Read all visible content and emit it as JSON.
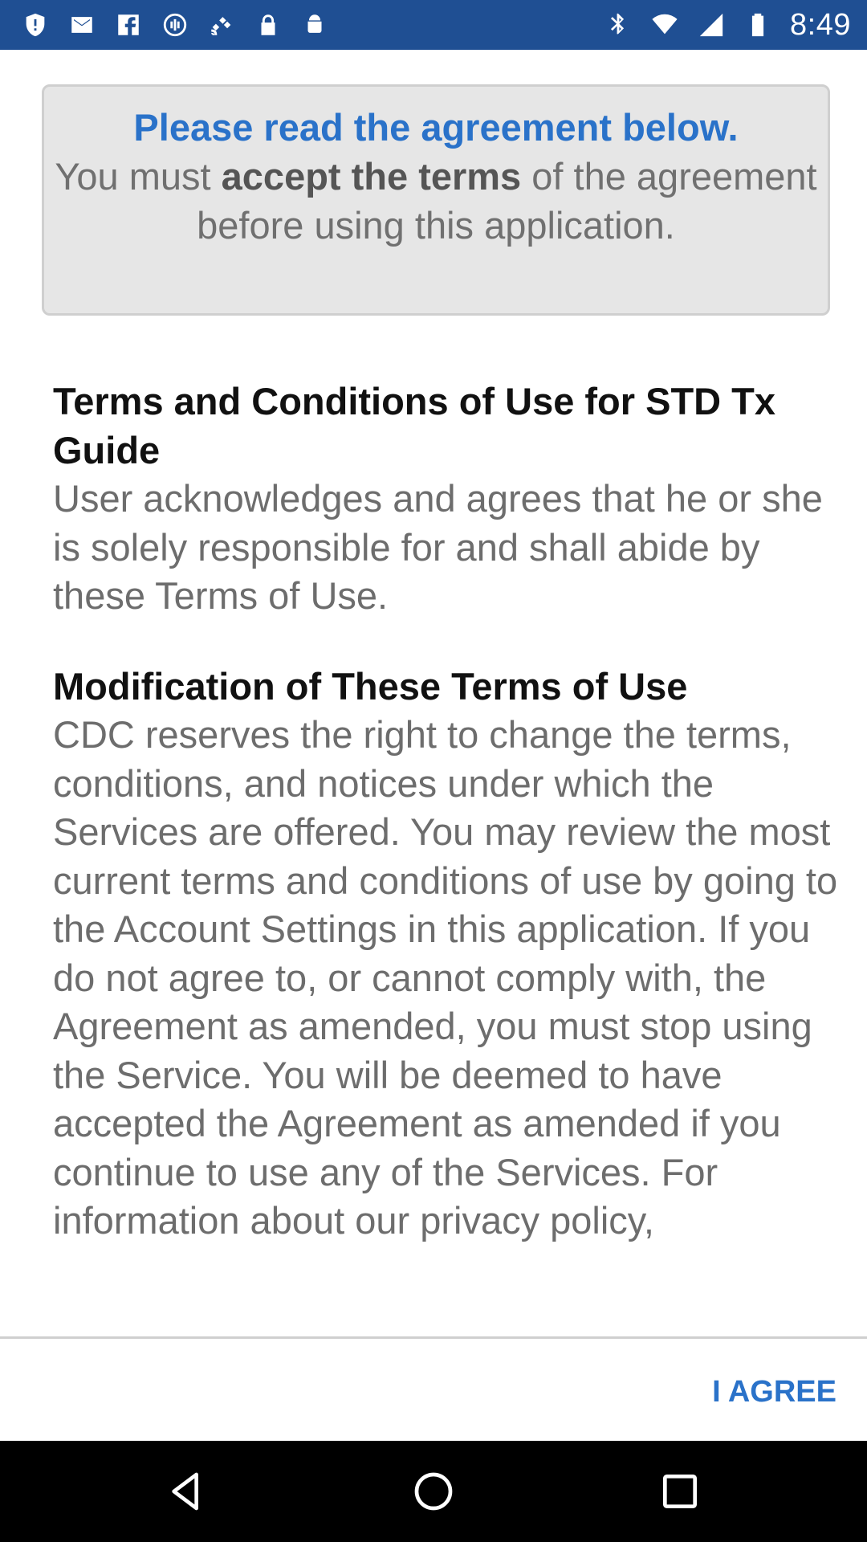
{
  "status_bar": {
    "time": "8:49",
    "icons": [
      "shield-icon",
      "mail-icon",
      "facebook-icon",
      "sync-circle-icon",
      "fake-gps-satellite-icon",
      "lock-icon",
      "android-icon",
      "bluetooth-icon",
      "wifi-icon",
      "signal-icon",
      "battery-icon"
    ]
  },
  "notice": {
    "lead": "Please read the agreement below.",
    "text_before": "You must ",
    "text_bold": "accept the terms",
    "text_after": " of the agreement before using this application."
  },
  "terms": {
    "title": "Terms and Conditions of Use for STD Tx Guide",
    "intro": "User acknowledges and agrees that he or she is solely responsible for and shall abide by these Terms of Use.",
    "section_title": "Modification of These Terms of Use",
    "section_body": "CDC reserves the right to change the terms, conditions, and notices under which the Services are offered. You may review the most current terms and conditions of use by going to the Account Settings in this application. If you do not agree to, or cannot comply with, the Agreement as amended, you must stop using the Service. You will be deemed to have accepted the Agreement as amended if you continue to use any of the Services. For information about our privacy policy,"
  },
  "actions": {
    "agree_label": "I AGREE"
  },
  "nav_bar": {
    "buttons": [
      "back-icon",
      "home-icon",
      "recents-icon"
    ]
  },
  "colors": {
    "status_bar": "#1f4f93",
    "accent": "#2a72c9",
    "notice_bg": "#e6e6e6",
    "body_text": "#6d6d6d"
  }
}
